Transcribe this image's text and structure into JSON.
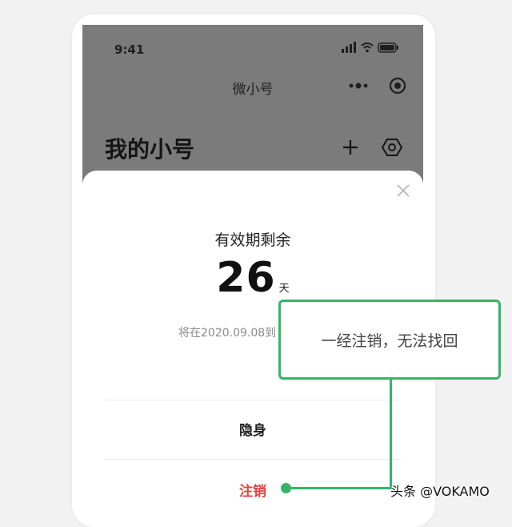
{
  "status_bar": {
    "time": "9:41"
  },
  "nav": {
    "title": "微小号"
  },
  "page": {
    "title": "我的小号"
  },
  "sheet": {
    "validity_label": "有效期剩余",
    "days_value": "26",
    "days_unit": "天",
    "expire_text": "将在2020.09.08到",
    "hide_label": "隐身",
    "cancel_label": "注销"
  },
  "callout": {
    "text": "一经注销，无法找回"
  },
  "watermark": {
    "text": "头条 @VOKAMO"
  },
  "colors": {
    "accent_green": "#35b46a",
    "danger_red": "#e3433f",
    "overlay_gray": "#7b7b7b"
  },
  "icons": [
    "signal-icon",
    "wifi-icon",
    "battery-icon",
    "more-icon",
    "capsule-close-icon",
    "add-icon",
    "settings-icon",
    "close-icon"
  ]
}
